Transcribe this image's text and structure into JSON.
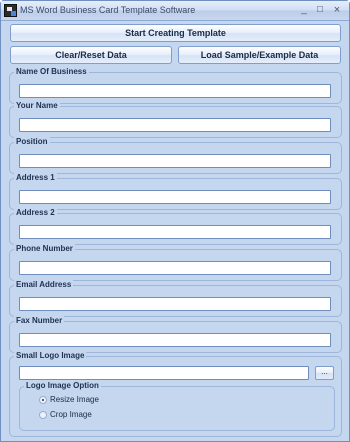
{
  "window": {
    "title": "MS Word Business Card Template Software",
    "minimize_glyph": "_",
    "maximize_glyph": "□",
    "close_glyph": "×"
  },
  "buttons": {
    "start": "Start Creating Template",
    "clear": "Clear/Reset Data",
    "load": "Load Sample/Example Data"
  },
  "fields": [
    {
      "label": "Name Of Business",
      "value": ""
    },
    {
      "label": "Your Name",
      "value": ""
    },
    {
      "label": "Position",
      "value": ""
    },
    {
      "label": "Address 1",
      "value": ""
    },
    {
      "label": "Address 2",
      "value": ""
    },
    {
      "label": "Phone Number",
      "value": ""
    },
    {
      "label": "Email Address",
      "value": ""
    },
    {
      "label": "Fax Number",
      "value": ""
    }
  ],
  "logo": {
    "label": "Small Logo Image",
    "value": "",
    "browse_label": "...",
    "option_group_label": "Logo Image Option",
    "options": [
      {
        "label": "Resize Image",
        "selected": true
      },
      {
        "label": "Crop Image",
        "selected": false
      }
    ]
  }
}
